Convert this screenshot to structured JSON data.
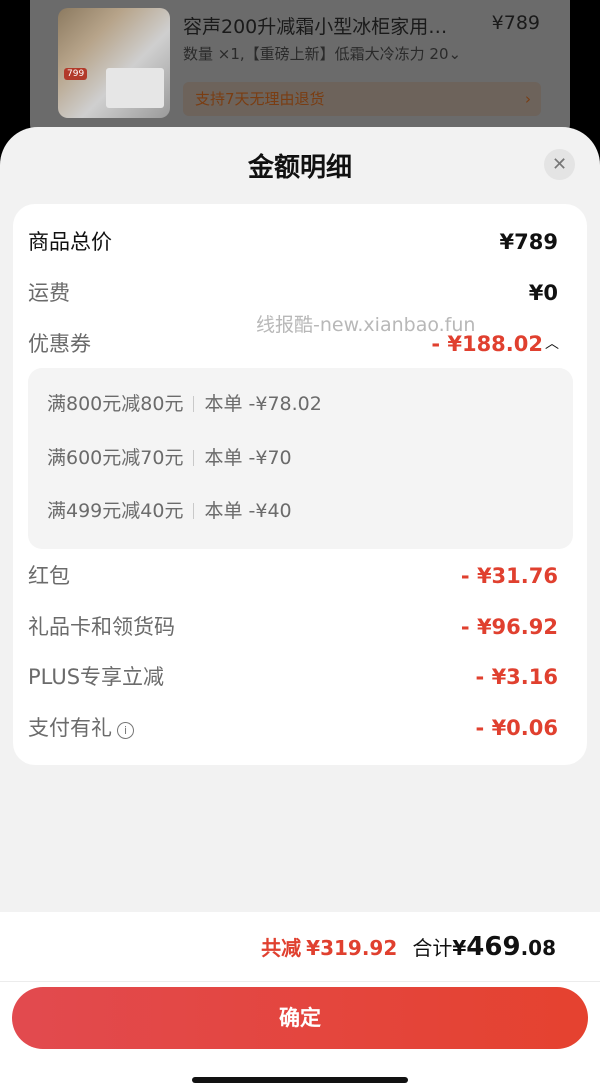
{
  "background_product": {
    "title": "容声200升减霜小型冰柜家用…",
    "price": "¥789",
    "desc": "数量 ×1,【重磅上新】低霜大冷冻力 20",
    "return_policy": "支持7天无理由退货",
    "thumb_badge": "799"
  },
  "sheet": {
    "title": "金额明细",
    "close_icon": "close-icon"
  },
  "details": {
    "total_price_label": "商品总价",
    "total_price_value": "¥789",
    "shipping_label": "运费",
    "shipping_value": "¥0",
    "coupon_label": "优惠券",
    "coupon_value": "- ¥188.02",
    "coupons": [
      {
        "name": "满800元减80元",
        "scope": "本单",
        "amount": "-¥78.02"
      },
      {
        "name": "满600元减70元",
        "scope": "本单",
        "amount": "-¥70"
      },
      {
        "name": "满499元减40元",
        "scope": "本单",
        "amount": "-¥40"
      }
    ],
    "redpacket_label": "红包",
    "redpacket_value": "- ¥31.76",
    "giftcard_label": "礼品卡和领货码",
    "giftcard_value": "- ¥96.92",
    "plus_label": "PLUS专享立减",
    "plus_value": "- ¥3.16",
    "paygift_label": "支付有礼",
    "paygift_value": "- ¥0.06"
  },
  "watermark": "线报酷-new.xianbao.fun",
  "footer": {
    "saved_label": "共减",
    "saved_amount": "¥319.92",
    "total_label": "合计",
    "total_symbol": "¥",
    "total_int": "469",
    "total_dec": ".08",
    "confirm_label": "确定"
  },
  "colors": {
    "accent_red": "#e0402f",
    "button_gradient_start": "#e24a4f",
    "button_gradient_end": "#e5422f"
  }
}
